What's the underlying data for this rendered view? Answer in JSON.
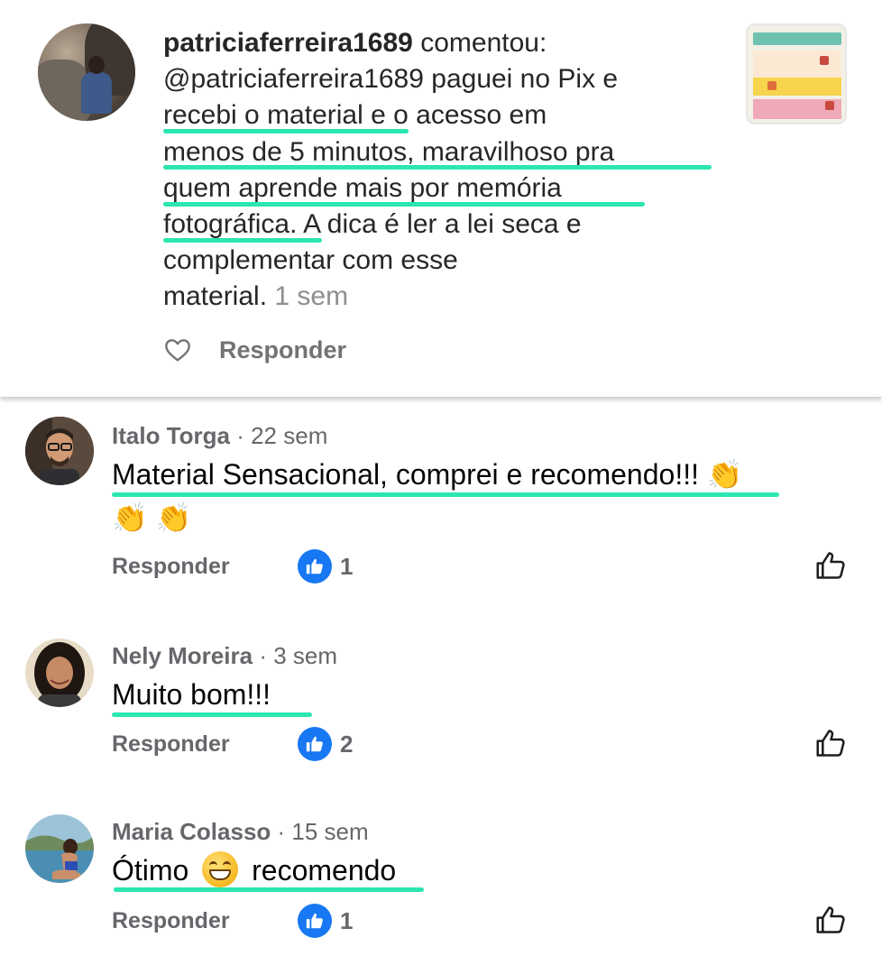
{
  "ig_comment": {
    "username": "patriciaferreira1689",
    "verb": "comentou:",
    "lines": [
      "@patriciaferreira1689 paguei no Pix e",
      "recebi o material e o acesso em",
      "menos de 5 minutos, maravilhoso pra",
      "quem aprende mais por memória",
      "fotográfica. A dica é ler a lei seca e",
      "complementar com esse",
      "material."
    ],
    "time": "1 sem",
    "reply_label": "Responder",
    "like_icon": "heart-icon"
  },
  "comments": [
    {
      "name": "Italo Torga",
      "time": "· 22 sem",
      "text_line1": "Material Sensacional, comprei e recomendo!!!",
      "emoji_a": "👏",
      "emoji_b": "👏",
      "emoji_c": "👏",
      "reply_label": "Responder",
      "likes": "1"
    },
    {
      "name": "Nely Moreira",
      "time": "· 3 sem",
      "text": "Muito bom!!!",
      "reply_label": "Responder",
      "likes": "2"
    },
    {
      "name": "Maria Colasso",
      "time": "· 15 sem",
      "text_before": "Ótimo",
      "text_after": "recomendo",
      "emoji_icon": "grinning-face-icon",
      "reply_label": "Responder",
      "likes": "1"
    }
  ],
  "colors": {
    "highlight": "#2be6b0",
    "like_blue": "#1877f2",
    "muted": "#65676b"
  }
}
